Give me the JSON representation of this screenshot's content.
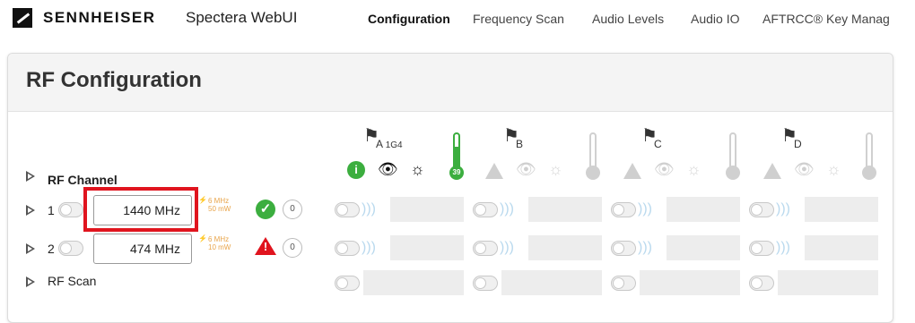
{
  "header": {
    "brand": "SENNHEISER",
    "app_name": "Spectera WebUI",
    "nav": [
      "Configuration",
      "Frequency Scan",
      "Audio Levels",
      "Audio IO",
      "AFTRCC® Key Manag"
    ]
  },
  "panel": {
    "title": "RF Configuration",
    "rf_channel_label": "RF Channel",
    "rf_scan_label": "RF Scan",
    "channels": [
      {
        "label": "A",
        "sub": "1G4",
        "temp": "39",
        "active": true
      },
      {
        "label": "B",
        "sub": "",
        "active": false
      },
      {
        "label": "C",
        "sub": "",
        "active": false
      },
      {
        "label": "D",
        "sub": "",
        "active": false
      }
    ],
    "rows": [
      {
        "num": "1",
        "freq": "1440  MHz",
        "bw": "6 MHz",
        "power": "50 mW",
        "status": "ok",
        "btn": "0"
      },
      {
        "num": "2",
        "freq": "474  MHz",
        "bw": "6 MHz",
        "power": "10 mW",
        "status": "warning",
        "btn": "0"
      }
    ]
  },
  "colors": {
    "highlight": "#e0141e",
    "ok": "#3cae3f",
    "warning": "#e0141e",
    "antenna": "#e8a44a"
  },
  "icons": [
    "sennheiser-logo",
    "info-icon",
    "eye-icon",
    "sun-icon",
    "thermometer-icon",
    "antenna-icon",
    "check-icon",
    "warning-icon",
    "wifi-icon",
    "flag-icon"
  ]
}
